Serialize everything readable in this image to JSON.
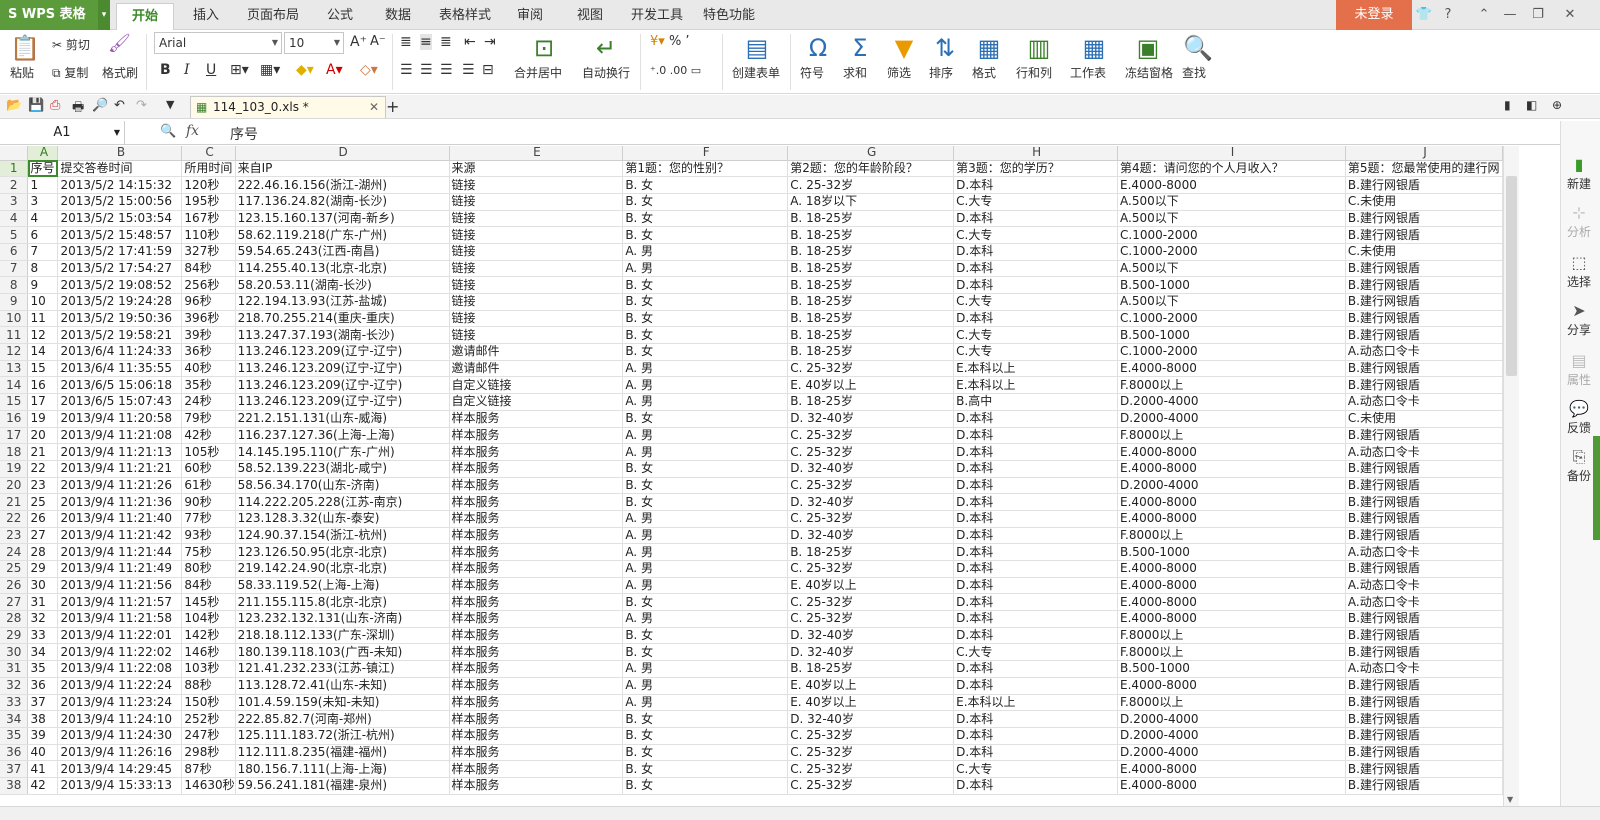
{
  "app": {
    "logo": "S WPS 表格"
  },
  "ribbon_tabs": [
    "开始",
    "插入",
    "页面布局",
    "公式",
    "数据",
    "表格样式",
    "审阅",
    "视图",
    "开发工具",
    "特色功能"
  ],
  "window": {
    "login": "未登录",
    "help": "?"
  },
  "toolbar": {
    "paste": "粘贴",
    "cut": "剪切",
    "copy": "复制",
    "format_painter": "格式刷",
    "font": "Arial",
    "font_size": "10",
    "bold": "B",
    "italic": "I",
    "underline": "U",
    "merge_center": "合并居中",
    "wrap_text": "自动换行",
    "create_form": "创建表单",
    "symbol": "符号",
    "sum": "求和",
    "filter": "筛选",
    "sort": "排序",
    "format": "格式",
    "rows_cols": "行和列",
    "worksheet": "工作表",
    "freeze": "冻结窗格",
    "find": "查找"
  },
  "document": {
    "tab_name": "114_103_0.xls *"
  },
  "formula_bar": {
    "cell_ref": "A1",
    "fx": "fx",
    "value": "序号"
  },
  "sidebar": {
    "items": [
      "新建",
      "分析",
      "选择",
      "分享",
      "属性",
      "反馈",
      "备份"
    ]
  },
  "sheet": {
    "col_letters": [
      "A",
      "B",
      "C",
      "D",
      "E",
      "F",
      "G",
      "H",
      "I",
      "J"
    ],
    "headers": [
      "序号",
      "提交答卷时间",
      "所用时间",
      "来自IP",
      "来源",
      "第1题：您的性别？",
      "第2题：您的年龄阶段？",
      "第3题：您的学历？",
      "第4题：请问您的个人月收入？",
      "第5题：您最常使用的建行网"
    ],
    "rows": [
      [
        "1",
        "2013/5/2 14:15:32",
        "120秒",
        "222.46.16.156(浙江-湖州)",
        "链接",
        "B. 女",
        "C. 25-32岁",
        "D.本科",
        "E.4000-8000",
        "B.建行网银盾"
      ],
      [
        "3",
        "2013/5/2 15:00:56",
        "195秒",
        "117.136.24.82(湖南-长沙)",
        "链接",
        "B. 女",
        "A. 18岁以下",
        "C.大专",
        "A.500以下",
        "C.未使用"
      ],
      [
        "4",
        "2013/5/2 15:03:54",
        "167秒",
        "123.15.160.137(河南-新乡)",
        "链接",
        "B. 女",
        "B. 18-25岁",
        "D.本科",
        "A.500以下",
        "B.建行网银盾"
      ],
      [
        "6",
        "2013/5/2 15:48:57",
        "110秒",
        "58.62.119.218(广东-广州)",
        "链接",
        "B. 女",
        "B. 18-25岁",
        "C.大专",
        "C.1000-2000",
        "B.建行网银盾"
      ],
      [
        "7",
        "2013/5/2 17:41:59",
        "327秒",
        "59.54.65.243(江西-南昌)",
        "链接",
        "A. 男",
        "B. 18-25岁",
        "D.本科",
        "C.1000-2000",
        "C.未使用"
      ],
      [
        "8",
        "2013/5/2 17:54:27",
        "84秒",
        "114.255.40.13(北京-北京)",
        "链接",
        "A. 男",
        "B. 18-25岁",
        "D.本科",
        "A.500以下",
        "B.建行网银盾"
      ],
      [
        "9",
        "2013/5/2 19:08:52",
        "256秒",
        "58.20.53.11(湖南-长沙)",
        "链接",
        "B. 女",
        "B. 18-25岁",
        "D.本科",
        "B.500-1000",
        "B.建行网银盾"
      ],
      [
        "10",
        "2013/5/2 19:24:28",
        "96秒",
        "122.194.13.93(江苏-盐城)",
        "链接",
        "B. 女",
        "B. 18-25岁",
        "C.大专",
        "A.500以下",
        "B.建行网银盾"
      ],
      [
        "11",
        "2013/5/2 19:50:36",
        "396秒",
        "218.70.255.214(重庆-重庆)",
        "链接",
        "B. 女",
        "B. 18-25岁",
        "D.本科",
        "C.1000-2000",
        "B.建行网银盾"
      ],
      [
        "12",
        "2013/5/2 19:58:21",
        "39秒",
        "113.247.37.193(湖南-长沙)",
        "链接",
        "B. 女",
        "B. 18-25岁",
        "C.大专",
        "B.500-1000",
        "B.建行网银盾"
      ],
      [
        "14",
        "2013/6/4 11:24:33",
        "36秒",
        "113.246.123.209(辽宁-辽宁)",
        "邀请邮件",
        "B. 女",
        "B. 18-25岁",
        "C.大专",
        "C.1000-2000",
        "A.动态口令卡"
      ],
      [
        "15",
        "2013/6/4 11:35:55",
        "40秒",
        "113.246.123.209(辽宁-辽宁)",
        "邀请邮件",
        "A. 男",
        "C. 25-32岁",
        "E.本科以上",
        "E.4000-8000",
        "B.建行网银盾"
      ],
      [
        "16",
        "2013/6/5 15:06:18",
        "35秒",
        "113.246.123.209(辽宁-辽宁)",
        "自定义链接",
        "A. 男",
        "E. 40岁以上",
        "E.本科以上",
        "F.8000以上",
        "B.建行网银盾"
      ],
      [
        "17",
        "2013/6/5 15:07:43",
        "24秒",
        "113.246.123.209(辽宁-辽宁)",
        "自定义链接",
        "A. 男",
        "B. 18-25岁",
        "B.高中",
        "D.2000-4000",
        "A.动态口令卡"
      ],
      [
        "19",
        "2013/9/4 11:20:58",
        "79秒",
        "221.2.151.131(山东-威海)",
        "样本服务",
        "B. 女",
        "D. 32-40岁",
        "D.本科",
        "D.2000-4000",
        "C.未使用"
      ],
      [
        "20",
        "2013/9/4 11:21:08",
        "42秒",
        "116.237.127.36(上海-上海)",
        "样本服务",
        "A. 男",
        "C. 25-32岁",
        "D.本科",
        "F.8000以上",
        "B.建行网银盾"
      ],
      [
        "21",
        "2013/9/4 11:21:13",
        "105秒",
        "14.145.195.110(广东-广州)",
        "样本服务",
        "A. 男",
        "C. 25-32岁",
        "D.本科",
        "E.4000-8000",
        "A.动态口令卡"
      ],
      [
        "22",
        "2013/9/4 11:21:21",
        "60秒",
        "58.52.139.223(湖北-咸宁)",
        "样本服务",
        "B. 女",
        "D. 32-40岁",
        "D.本科",
        "E.4000-8000",
        "B.建行网银盾"
      ],
      [
        "23",
        "2013/9/4 11:21:26",
        "61秒",
        "58.56.34.170(山东-济南)",
        "样本服务",
        "B. 女",
        "C. 25-32岁",
        "D.本科",
        "D.2000-4000",
        "B.建行网银盾"
      ],
      [
        "25",
        "2013/9/4 11:21:36",
        "90秒",
        "114.222.205.228(江苏-南京)",
        "样本服务",
        "B. 女",
        "D. 32-40岁",
        "D.本科",
        "E.4000-8000",
        "B.建行网银盾"
      ],
      [
        "26",
        "2013/9/4 11:21:40",
        "77秒",
        "123.128.3.32(山东-泰安)",
        "样本服务",
        "A. 男",
        "C. 25-32岁",
        "D.本科",
        "E.4000-8000",
        "B.建行网银盾"
      ],
      [
        "27",
        "2013/9/4 11:21:42",
        "93秒",
        "124.90.37.154(浙江-杭州)",
        "样本服务",
        "A. 男",
        "D. 32-40岁",
        "D.本科",
        "F.8000以上",
        "B.建行网银盾"
      ],
      [
        "28",
        "2013/9/4 11:21:44",
        "75秒",
        "123.126.50.95(北京-北京)",
        "样本服务",
        "A. 男",
        "B. 18-25岁",
        "D.本科",
        "B.500-1000",
        "A.动态口令卡"
      ],
      [
        "29",
        "2013/9/4 11:21:49",
        "80秒",
        "219.142.24.90(北京-北京)",
        "样本服务",
        "A. 男",
        "C. 25-32岁",
        "D.本科",
        "E.4000-8000",
        "B.建行网银盾"
      ],
      [
        "30",
        "2013/9/4 11:21:56",
        "84秒",
        "58.33.119.52(上海-上海)",
        "样本服务",
        "A. 男",
        "E. 40岁以上",
        "D.本科",
        "E.4000-8000",
        "A.动态口令卡"
      ],
      [
        "31",
        "2013/9/4 11:21:57",
        "145秒",
        "211.155.115.8(北京-北京)",
        "样本服务",
        "B. 女",
        "C. 25-32岁",
        "D.本科",
        "E.4000-8000",
        "A.动态口令卡"
      ],
      [
        "32",
        "2013/9/4 11:21:58",
        "104秒",
        "123.232.132.131(山东-济南)",
        "样本服务",
        "A. 男",
        "C. 25-32岁",
        "D.本科",
        "E.4000-8000",
        "B.建行网银盾"
      ],
      [
        "33",
        "2013/9/4 11:22:01",
        "142秒",
        "218.18.112.133(广东-深圳)",
        "样本服务",
        "B. 女",
        "D. 32-40岁",
        "D.本科",
        "F.8000以上",
        "B.建行网银盾"
      ],
      [
        "34",
        "2013/9/4 11:22:02",
        "146秒",
        "180.139.118.103(广西-未知)",
        "样本服务",
        "B. 女",
        "D. 32-40岁",
        "C.大专",
        "F.8000以上",
        "B.建行网银盾"
      ],
      [
        "35",
        "2013/9/4 11:22:08",
        "103秒",
        "121.41.232.233(江苏-镇江)",
        "样本服务",
        "A. 男",
        "B. 18-25岁",
        "D.本科",
        "B.500-1000",
        "A.动态口令卡"
      ],
      [
        "36",
        "2013/9/4 11:22:24",
        "88秒",
        "113.128.72.41(山东-未知)",
        "样本服务",
        "A. 男",
        "E. 40岁以上",
        "D.本科",
        "E.4000-8000",
        "B.建行网银盾"
      ],
      [
        "37",
        "2013/9/4 11:23:24",
        "150秒",
        "101.4.59.159(未知-未知)",
        "样本服务",
        "A. 男",
        "E. 40岁以上",
        "E.本科以上",
        "F.8000以上",
        "B.建行网银盾"
      ],
      [
        "38",
        "2013/9/4 11:24:10",
        "252秒",
        "222.85.82.7(河南-郑州)",
        "样本服务",
        "B. 女",
        "D. 32-40岁",
        "D.本科",
        "D.2000-4000",
        "B.建行网银盾"
      ],
      [
        "39",
        "2013/9/4 11:24:30",
        "247秒",
        "125.111.183.72(浙江-杭州)",
        "样本服务",
        "B. 女",
        "C. 25-32岁",
        "D.本科",
        "D.2000-4000",
        "B.建行网银盾"
      ],
      [
        "40",
        "2013/9/4 11:26:16",
        "298秒",
        "112.111.8.235(福建-福州)",
        "样本服务",
        "B. 女",
        "C. 25-32岁",
        "D.本科",
        "D.2000-4000",
        "B.建行网银盾"
      ],
      [
        "41",
        "2013/9/4 14:29:45",
        "87秒",
        "180.156.7.111(上海-上海)",
        "样本服务",
        "B. 女",
        "C. 25-32岁",
        "C.大专",
        "E.4000-8000",
        "B.建行网银盾"
      ],
      [
        "42",
        "2013/9/4 15:33:13",
        "14630秒",
        "59.56.241.181(福建-泉州)",
        "样本服务",
        "B. 女",
        "C. 25-32岁",
        "D.本科",
        "E.4000-8000",
        "B.建行网银盾"
      ]
    ]
  },
  "colors": {
    "accent_green": "#3c8a28",
    "login_orange": "#e4704b",
    "logo_green": "#5b9b3c"
  }
}
